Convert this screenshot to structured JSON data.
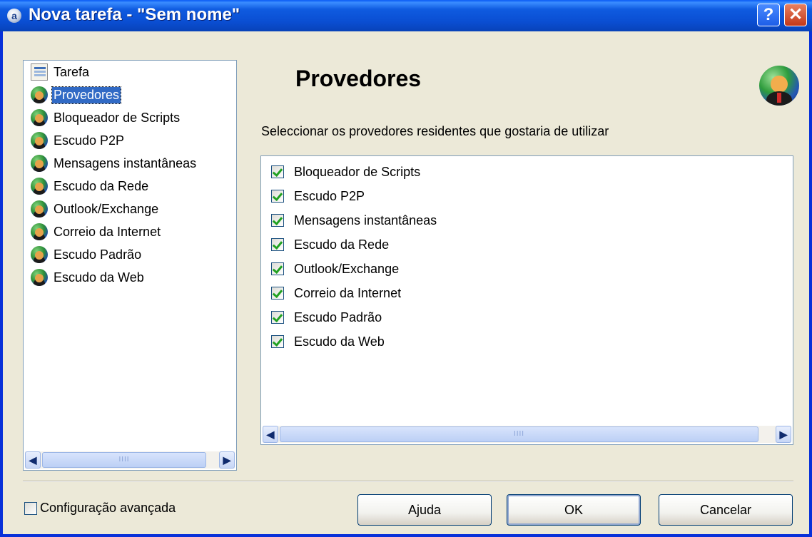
{
  "window": {
    "title": "Nova tarefa - \"Sem nome\"",
    "help_btn": "?",
    "close_btn": "✕",
    "app_icon_letter": "a"
  },
  "tree": {
    "items": [
      {
        "label": "Tarefa",
        "icon": "task-icon"
      },
      {
        "label": "Provedores",
        "icon": "provider-icon",
        "selected": true
      },
      {
        "label": "Bloqueador de Scripts",
        "icon": "provider-icon"
      },
      {
        "label": "Escudo P2P",
        "icon": "provider-icon"
      },
      {
        "label": "Mensagens instantâneas",
        "icon": "provider-icon"
      },
      {
        "label": "Escudo da Rede",
        "icon": "provider-icon"
      },
      {
        "label": "Outlook/Exchange",
        "icon": "provider-icon"
      },
      {
        "label": "Correio da Internet",
        "icon": "provider-icon"
      },
      {
        "label": "Escudo Padrão",
        "icon": "provider-icon"
      },
      {
        "label": "Escudo da Web",
        "icon": "provider-icon"
      }
    ]
  },
  "main": {
    "heading": "Provedores",
    "description": "Seleccionar os provedores residentes que gostaria de utilizar",
    "providers": [
      {
        "label": "Bloqueador de Scripts",
        "checked": true
      },
      {
        "label": "Escudo P2P",
        "checked": true
      },
      {
        "label": "Mensagens instantâneas",
        "checked": true
      },
      {
        "label": "Escudo da Rede",
        "checked": true
      },
      {
        "label": "Outlook/Exchange",
        "checked": true
      },
      {
        "label": "Correio da Internet",
        "checked": true
      },
      {
        "label": "Escudo Padrão",
        "checked": true
      },
      {
        "label": "Escudo da Web",
        "checked": true
      }
    ]
  },
  "footer": {
    "advanced_label": "Configuração avançada",
    "advanced_checked": false,
    "buttons": {
      "help": "Ajuda",
      "ok": "OK",
      "cancel": "Cancelar"
    }
  },
  "scrollbar": {
    "left_arrow": "◀",
    "right_arrow": "▶",
    "grip": "IIII"
  },
  "colors": {
    "titlebar": "#0A4ED2",
    "selection": "#316AC5",
    "dialog_bg": "#ECE9D8",
    "check": "#21A121"
  }
}
